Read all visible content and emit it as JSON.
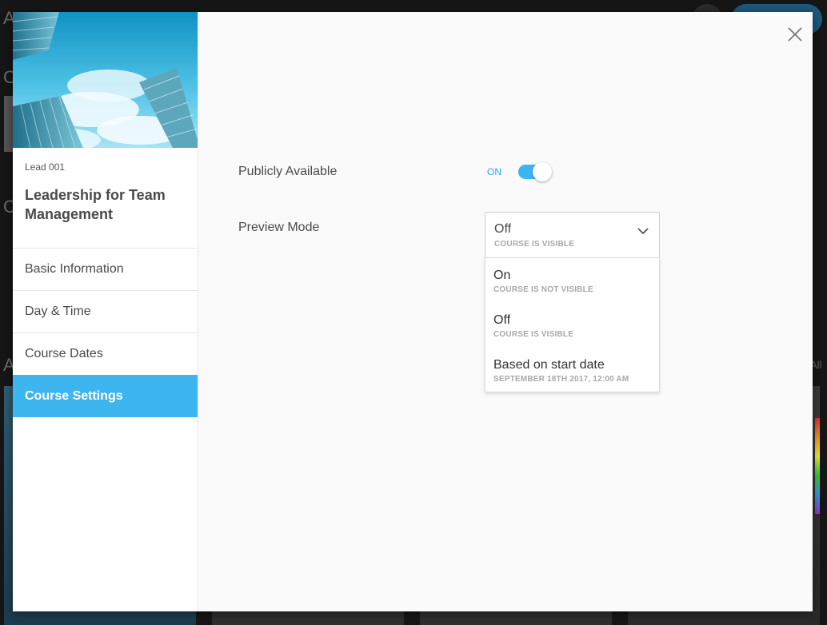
{
  "background": {
    "letters": [
      "A",
      "C",
      "C",
      "A"
    ],
    "view_all": "All"
  },
  "course": {
    "code": "Lead 001",
    "title": "Leadership for Team Management"
  },
  "nav": {
    "items": [
      {
        "label": "Basic Information",
        "active": false
      },
      {
        "label": "Day & Time",
        "active": false
      },
      {
        "label": "Course Dates",
        "active": false
      },
      {
        "label": "Course Settings",
        "active": true
      }
    ]
  },
  "settings": {
    "publicly_available": {
      "label": "Publicly Available",
      "state_text": "ON",
      "enabled": true
    },
    "preview_mode": {
      "label": "Preview Mode",
      "selected": {
        "label": "Off",
        "sub": "COURSE IS VISIBLE"
      },
      "options": [
        {
          "label": "On",
          "sub": "COURSE IS NOT VISIBLE"
        },
        {
          "label": "Off",
          "sub": "COURSE IS VISIBLE"
        },
        {
          "label": "Based on start date",
          "sub": "SEPTEMBER 18TH 2017, 12:00 AM"
        }
      ]
    }
  },
  "icons": {
    "close": "close-icon",
    "chevron": "chevron-down-icon"
  },
  "colors": {
    "accent": "#3db5ef",
    "toggle_text": "#2ea6e3",
    "sidebar_bg": "#ffffff",
    "content_bg": "#fafafa"
  }
}
